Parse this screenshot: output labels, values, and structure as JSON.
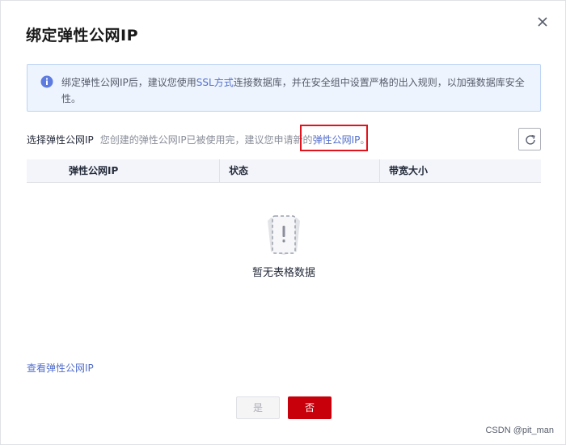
{
  "dialog": {
    "title": "绑定弹性公网IP"
  },
  "notice": {
    "text_before": "绑定弹性公网IP后，建议您使用",
    "link": "SSL方式",
    "text_after": "连接数据库，并在安全组中设置严格的出入规则，以加强数据库安全性。"
  },
  "selection": {
    "label": "选择弹性公网IP",
    "hint": "您创建的弹性公网IP已被使用完，建议您申请新的",
    "link": "弹性公网IP",
    "punct": "。"
  },
  "table": {
    "columns": [
      "弹性公网IP",
      "状态",
      "带宽大小"
    ],
    "empty_text": "暂无表格数据"
  },
  "footer": {
    "view_link": "查看弹性公网IP",
    "yes_label": "是",
    "no_label": "否"
  },
  "watermark": "CSDN @pit_man",
  "colors": {
    "primary_red": "#c7000b",
    "link_blue": "#526ecc",
    "info_bg": "#edf4fd",
    "highlight_red": "#e0141c"
  }
}
